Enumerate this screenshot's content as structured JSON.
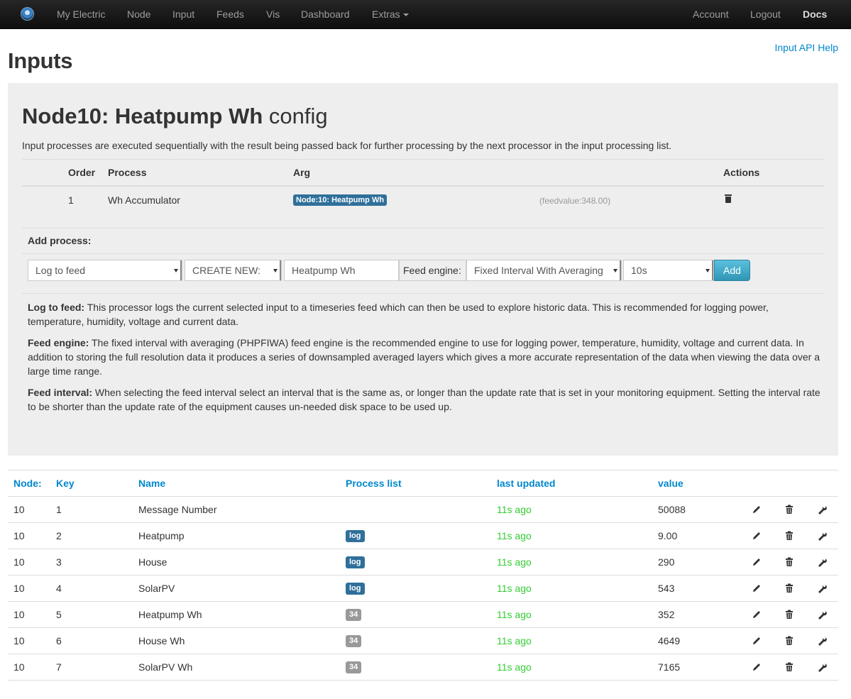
{
  "nav": {
    "left": [
      "My Electric",
      "Node",
      "Input",
      "Feeds",
      "Vis",
      "Dashboard",
      "Extras"
    ],
    "right": [
      "Account",
      "Logout",
      "Docs"
    ]
  },
  "page": {
    "title": "Inputs",
    "api_help": "Input API Help"
  },
  "config": {
    "title_bold": "Node10: Heatpump Wh",
    "title_rest": "config",
    "intro": "Input processes are executed sequentially with the result being passed back for further processing by the next processor in the input processing list.",
    "headers": [
      "Order",
      "Process",
      "Arg",
      "Actions"
    ],
    "rows": [
      {
        "order": "1",
        "process": "Wh Accumulator",
        "arg": "Node:10: Heatpump Wh",
        "value": "(feedvalue:348.00)"
      }
    ],
    "add_process_label": "Add process:",
    "form": {
      "process": "Log to feed",
      "feed_mode": "CREATE NEW:",
      "feed_name": "Heatpump Wh",
      "engine_label": "Feed engine:",
      "engine": "Fixed Interval With Averaging",
      "interval": "10s",
      "add_button": "Add"
    },
    "descriptions": [
      {
        "title": "Log to feed:",
        "text": " This processor logs the current selected input to a timeseries feed which can then be used to explore historic data. This is recommended for logging power, temperature, humidity, voltage and current data."
      },
      {
        "title": "Feed engine:",
        "text": " The fixed interval with averaging (PHPFIWA) feed engine is the recommended engine to use for logging power, temperature, humidity, voltage and current data. In addition to storing the full resolution data it produces a series of downsampled averaged layers which gives a more accurate representation of the data when viewing the data over a large time range."
      },
      {
        "title": "Feed interval:",
        "text": " When selecting the feed interval select an interval that is the same as, or longer than the update rate that is set in your monitoring equipment. Setting the interval rate to be shorter than the update rate of the equipment causes un-needed disk space to be used up."
      }
    ]
  },
  "inputs": {
    "headers": [
      "Node:",
      "Key",
      "Name",
      "Process list",
      "last updated",
      "value"
    ],
    "rows": [
      {
        "node": "10",
        "key": "1",
        "name": "Message Number",
        "process": "",
        "process_type": "",
        "updated": "11s ago",
        "value": "50088"
      },
      {
        "node": "10",
        "key": "2",
        "name": "Heatpump",
        "process": "log",
        "process_type": "log",
        "updated": "11s ago",
        "value": "9.00"
      },
      {
        "node": "10",
        "key": "3",
        "name": "House",
        "process": "log",
        "process_type": "log",
        "updated": "11s ago",
        "value": "290"
      },
      {
        "node": "10",
        "key": "4",
        "name": "SolarPV",
        "process": "log",
        "process_type": "log",
        "updated": "11s ago",
        "value": "543"
      },
      {
        "node": "10",
        "key": "5",
        "name": "Heatpump Wh",
        "process": "34",
        "process_type": "num",
        "updated": "11s ago",
        "value": "352"
      },
      {
        "node": "10",
        "key": "6",
        "name": "House Wh",
        "process": "34",
        "process_type": "num",
        "updated": "11s ago",
        "value": "4649"
      },
      {
        "node": "10",
        "key": "7",
        "name": "SolarPV Wh",
        "process": "34",
        "process_type": "num",
        "updated": "11s ago",
        "value": "7165"
      }
    ]
  },
  "colors": {
    "link": "#0088cc",
    "updated": "#33cc33",
    "log_badge": "#2f6f9a",
    "num_badge": "#999999"
  },
  "icons": [
    "pencil-icon",
    "trash-icon",
    "wrench-icon"
  ]
}
